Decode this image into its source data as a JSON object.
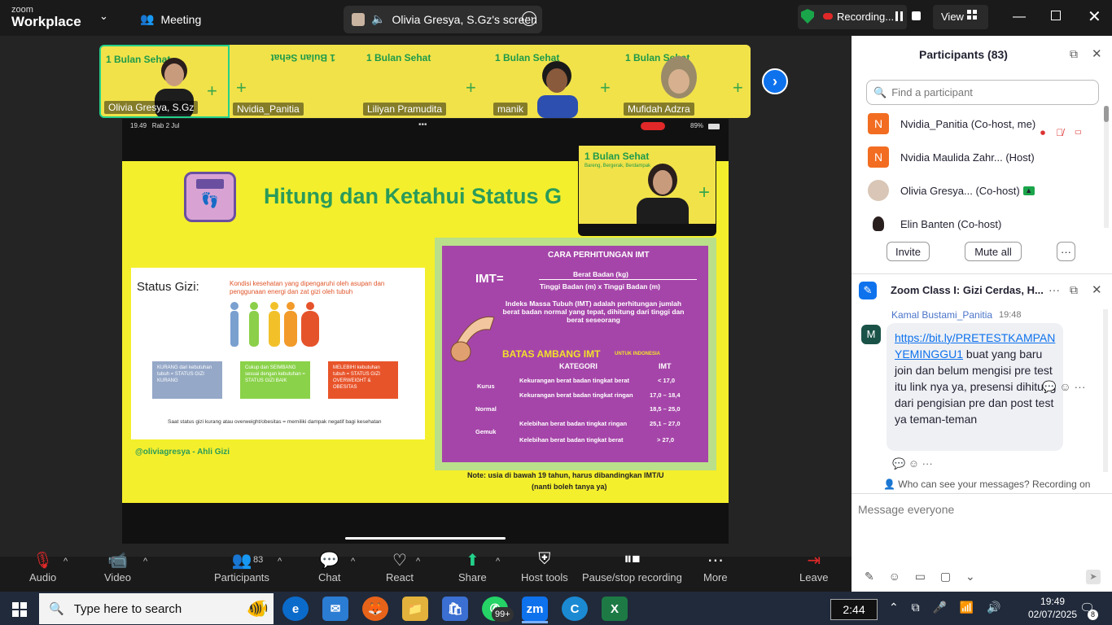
{
  "topbar": {
    "brand_top": "zoom",
    "brand_bottom": "Workplace",
    "meeting": "Meeting",
    "share_title": "Olivia Gresya, S.Gz's screen",
    "recording": "Recording...",
    "view": "View"
  },
  "thumbnails": [
    {
      "name": "Olivia Gresya, S.Gz"
    },
    {
      "name": "Nvidia_Panitia"
    },
    {
      "name": "Liliyan Pramudita"
    },
    {
      "name": "manik"
    },
    {
      "name": "Mufidah Adzra"
    }
  ],
  "slide": {
    "status_time": "19.49",
    "status_date": "Rab 2 Jul",
    "battery": "89%",
    "title": "Hitung dan Ketahui Status G",
    "banner": "1 Bulan Sehat",
    "banner_sub": "Bareng, Bergerak, Berdampak",
    "status_gizi_label": "Status Gizi:",
    "status_gizi_def": "Kondisi kesehatan yang dipengaruhi oleh asupan dan penggunaan energi dan zat gizi oleh tubuh",
    "box_kurang": "KURANG dari kebutuhan tubuh = STATUS GIZI KURANG",
    "box_cukup": "Cukup dan SEIMBANG sesuai dengan kebutuhan = STATUS GIZI BAIK",
    "box_lebih": "MELEBIHI kebutuhan tubuh = STATUS GIZI OVERWEIGHT & OBESITAS",
    "footnote": "Saat status gizi kurang atau overweight/obesitas = memiliki dampak negatif bagi kesehatan",
    "handle": "@oliviagresya - Ahli Gizi",
    "cara_title": "CARA PERHITUNGAN IMT",
    "imt_label": "IMT=",
    "numerator": "Berat Badan (kg)",
    "denominator": "Tinggi Badan (m) x Tinggi Badan (m)",
    "imt_desc": "Indeks Massa Tubuh (IMT) adalah perhitungan jumlah berat badan normal yang tepat, dihitung dari tinggi dan berat seseorang",
    "batas_title": "BATAS AMBANG IMT",
    "batas_sub": "UNTUK INDONESIA",
    "col_kategori": "KATEGORI",
    "col_imt": "IMT",
    "rows": [
      {
        "group": "Kurus",
        "desc": "Kekurangan berat badan tingkat berat",
        "val": "< 17,0"
      },
      {
        "group": "",
        "desc": "Kekurangan berat badan tingkat ringan",
        "val": "17,0 – 18,4"
      },
      {
        "group": "Normal",
        "desc": "",
        "val": "18,5 – 25,0"
      },
      {
        "group": "Gemuk",
        "desc": "Kelebihan berat badan tingkat ringan",
        "val": "25,1 – 27,0"
      },
      {
        "group": "",
        "desc": "Kelebihan berat badan tingkat berat",
        "val": "> 27,0"
      }
    ],
    "note1": "Note: usia di bawah 19 tahun, harus dibandingkan IMT/U",
    "note2": "(nanti boleh tanya ya)"
  },
  "participants": {
    "title": "Participants (83)",
    "search_placeholder": "Find a participant",
    "list": [
      {
        "initial": "N",
        "name": "Nvidia_Panitia (Co-host, me)",
        "color": "#f26d21"
      },
      {
        "initial": "N",
        "name": "Nvidia Maulida Zahr...  (Host)",
        "color": "#f26d21"
      },
      {
        "initial": "",
        "name": "Olivia Gresya...  (Co-host)",
        "color": "#c9b3a1"
      },
      {
        "initial": "",
        "name": "Elin Banten (Co-host)",
        "color": "#3b2a2a"
      }
    ],
    "invite": "Invite",
    "mute_all": "Mute all",
    "more": "···"
  },
  "chat": {
    "title": "Zoom Class I: Gizi Cerdas, H...",
    "sender": "Kamal Bustami_Panitia",
    "time": "19:48",
    "avatar": "M",
    "link": "https://bit.ly/PRETESTKAMPANYEMINGGU1",
    "message": " buat yang baru join dan belum mengisi pre test itu link nya ya, presensi dihitung dari pengisian pre dan post test ya teman-teman",
    "visibility": "Who can see your messages? Recording on",
    "input_placeholder": "Message everyone"
  },
  "toolbar": {
    "audio": "Audio",
    "video": "Video",
    "participants": "Participants",
    "participants_count": "83",
    "chat": "Chat",
    "react": "React",
    "share": "Share",
    "host_tools": "Host tools",
    "pause_stop": "Pause/stop recording",
    "more": "More",
    "leave": "Leave"
  },
  "taskbar": {
    "search": "Type here to search",
    "badge": "99+",
    "zm": "zm",
    "clock_widget": "2:44",
    "time": "19:49",
    "date": "02/07/2025",
    "notif": "8"
  }
}
